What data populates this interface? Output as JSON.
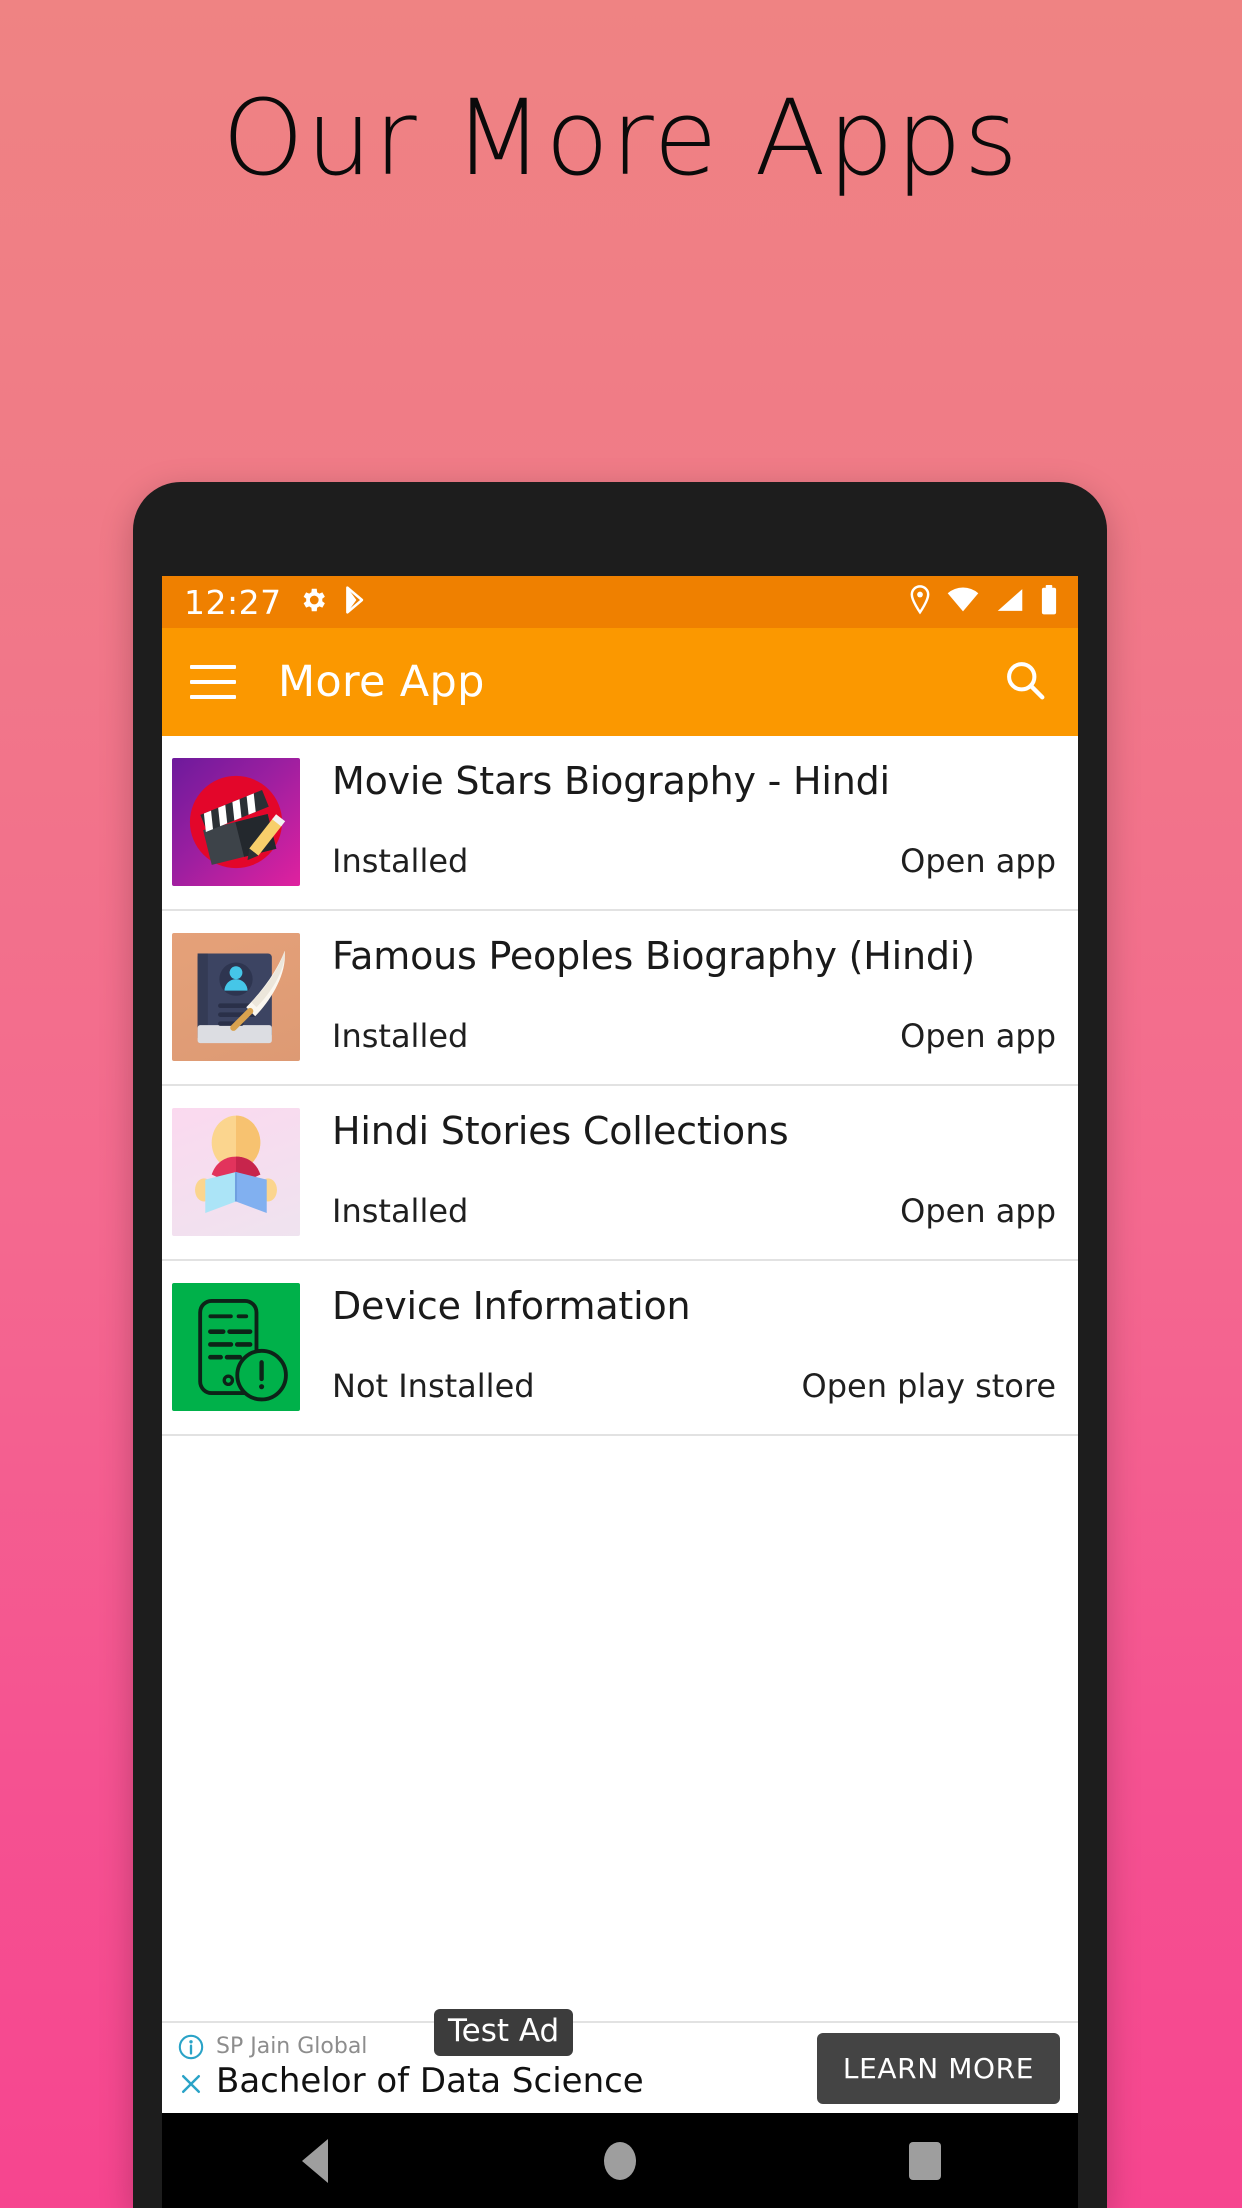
{
  "promo": {
    "title": "Our More Apps"
  },
  "theme": {
    "bg_top": "#ef8383",
    "bg_bottom": "#f6458f",
    "status_bar": "#ef8000",
    "app_bar": "#fb9800",
    "accent": "#fb9800"
  },
  "status_bar": {
    "time": "12:27",
    "left_icons": [
      "gear-icon",
      "play-store-icon"
    ],
    "right_icons": [
      "location-pin-icon",
      "wifi-icon",
      "signal-icon",
      "battery-icon"
    ]
  },
  "app_bar": {
    "title": "More App",
    "menu_icon": "hamburger-menu-icon",
    "search_icon": "search-icon"
  },
  "apps": [
    {
      "name": "Movie Stars Biography - Hindi",
      "status": "Installed",
      "action": "Open app",
      "icon": "movie-clapperboard-icon"
    },
    {
      "name": "Famous Peoples Biography (Hindi)",
      "status": "Installed",
      "action": "Open app",
      "icon": "biography-book-quill-icon"
    },
    {
      "name": "Hindi Stories Collections",
      "status": "Installed",
      "action": "Open app",
      "icon": "person-reading-book-icon"
    },
    {
      "name": "Device Information",
      "status": "Not Installed",
      "action": "Open play store",
      "icon": "phone-info-icon"
    }
  ],
  "ad": {
    "advertiser": "SP Jain Global",
    "headline": "Bachelor of Data Science",
    "test_badge": "Test Ad",
    "cta": "LEARN MORE",
    "info_icon": "ad-info-icon",
    "close_icon": "ad-close-icon"
  },
  "nav_bar": {
    "back": "back-button",
    "home": "home-button",
    "recents": "recents-button"
  }
}
